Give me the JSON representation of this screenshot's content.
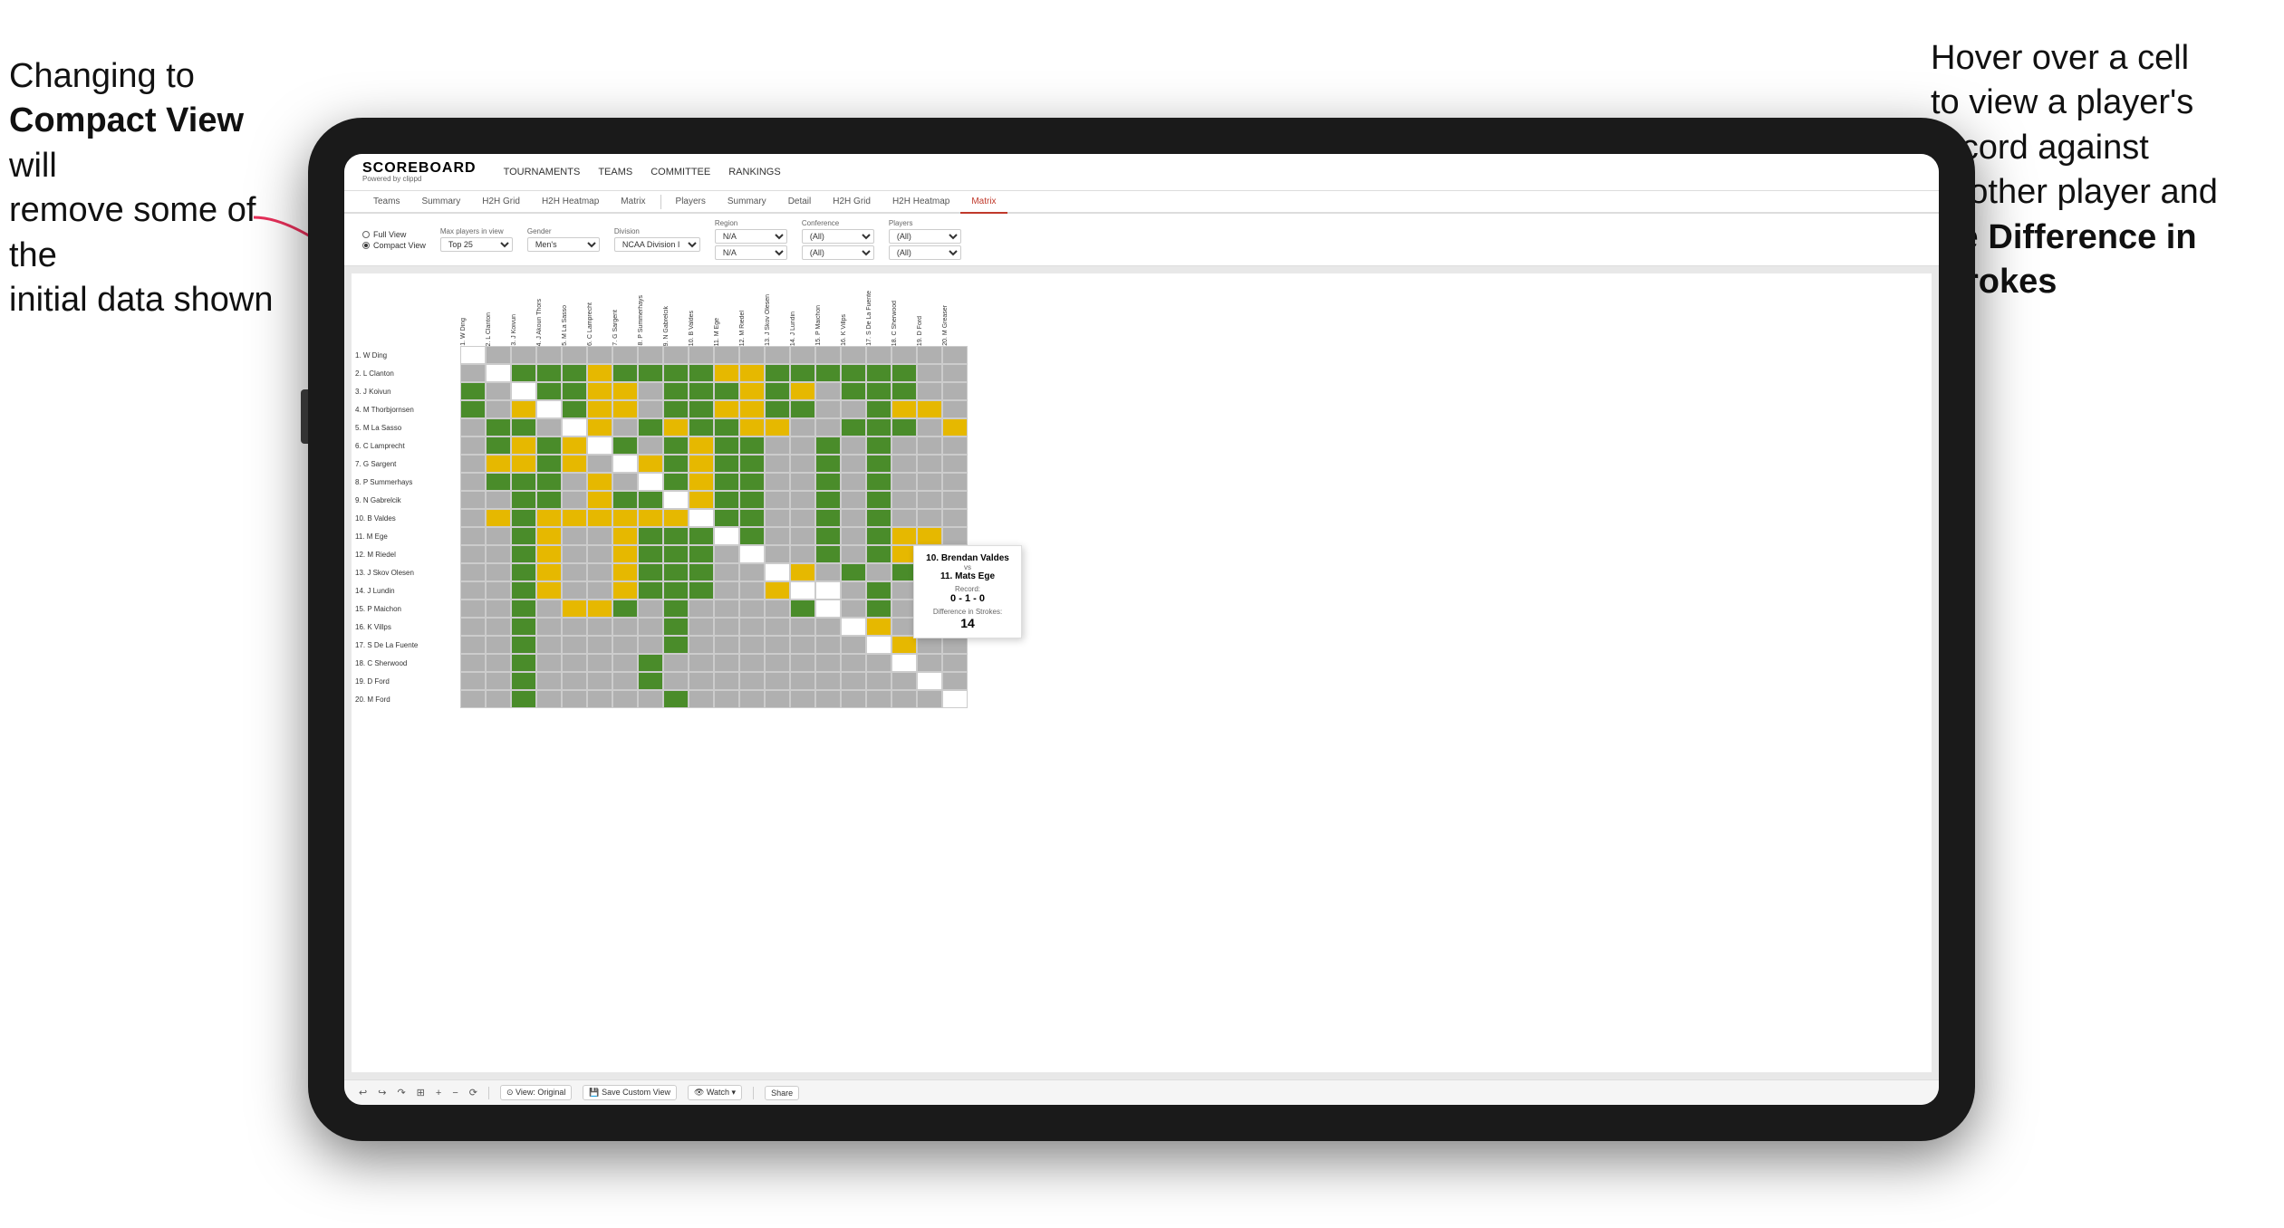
{
  "annotations": {
    "left": {
      "line1": "Changing to",
      "line2": "Compact View will",
      "line3": "remove some of the",
      "line4": "initial data shown"
    },
    "right": {
      "line1": "Hover over a cell",
      "line2": "to view a player's",
      "line3": "record against",
      "line4": "another player and",
      "line5": "the",
      "line6": "Difference in",
      "line7": "Strokes"
    }
  },
  "app": {
    "logo": "SCOREBOARD",
    "logo_sub": "Powered by clippd",
    "nav": [
      "TOURNAMENTS",
      "TEAMS",
      "COMMITTEE",
      "RANKINGS"
    ]
  },
  "tabs_group1": {
    "items": [
      "Teams",
      "Summary",
      "H2H Grid",
      "H2H Heatmap",
      "Matrix"
    ]
  },
  "tabs_group2": {
    "items": [
      "Players",
      "Summary",
      "Detail",
      "H2H Grid",
      "H2H Heatmap",
      "Matrix"
    ]
  },
  "filters": {
    "view_options": [
      "Full View",
      "Compact View"
    ],
    "view_selected": "Compact View",
    "max_players_label": "Max players in view",
    "max_players_value": "Top 25",
    "gender_label": "Gender",
    "gender_value": "Men's",
    "division_label": "Division",
    "division_value": "NCAA Division I",
    "region_label": "Region",
    "region_values": [
      "N/A",
      "N/A"
    ],
    "conference_label": "Conference",
    "conference_values": [
      "(All)",
      "(All)"
    ],
    "players_label": "Players",
    "players_values": [
      "(All)",
      "(All)"
    ]
  },
  "players": [
    "1. W Ding",
    "2. L Clanton",
    "3. J Koivun",
    "4. M Thorbjornsen",
    "5. M La Sasso",
    "6. C Lamprecht",
    "7. G Sargent",
    "8. P Summerhays",
    "9. N Gabrelcik",
    "10. B Valdes",
    "11. M Ege",
    "12. M Riedel",
    "13. J Skov Olesen",
    "14. J Lundin",
    "15. P Maichon",
    "16. K Villps",
    "17. S De La Fuente",
    "18. C Sherwood",
    "19. D Ford",
    "20. M Ford"
  ],
  "col_headers": [
    "1. W Ding",
    "2. L Clanton",
    "3. J Koivun",
    "4. J Akoun Thors",
    "5. M La Sasso",
    "6. C Lamprecht",
    "7. G Sargent",
    "8. P Summerhays",
    "9. N Gabrelcik",
    "10. B Valdes",
    "11. M Ege",
    "12. M Riedel",
    "13. J Skov Olesen",
    "14. J Lundin",
    "15. P Maichon",
    "16. K Villps",
    "17. S De La Fuente",
    "18. C Sherwood",
    "19. D Ford",
    "20. M Greaser"
  ],
  "tooltip": {
    "player1": "10. Brendan Valdes",
    "vs": "vs",
    "player2": "11. Mats Ege",
    "record_label": "Record:",
    "record_value": "0 - 1 - 0",
    "diff_label": "Difference in Strokes:",
    "diff_value": "14"
  },
  "toolbar": {
    "undo": "↩",
    "redo": "↪",
    "view_original": "⊙ View: Original",
    "save_custom": "💾 Save Custom View",
    "watch": "👁 Watch ▾",
    "share": "Share"
  },
  "colors": {
    "green": "#4a8c2a",
    "yellow": "#e6b800",
    "gray": "#b0b0b0",
    "active_tab": "#c0392b",
    "arrow": "#e8305a"
  }
}
